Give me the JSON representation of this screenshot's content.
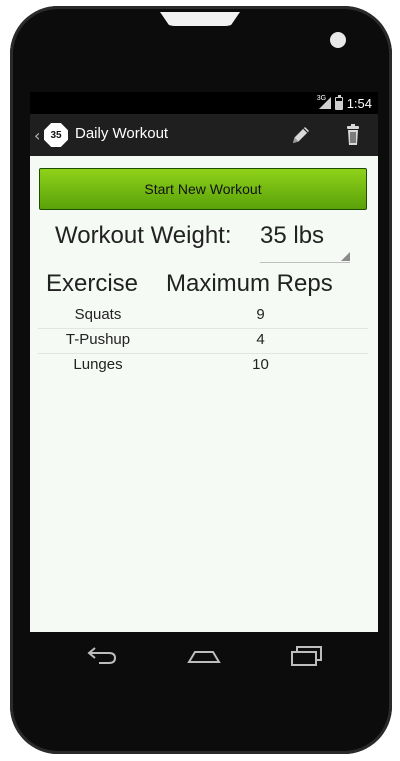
{
  "status_bar": {
    "network": "3G",
    "time": "1:54"
  },
  "action_bar": {
    "app_icon_text": "35",
    "title": "Daily Workout",
    "edit_icon": "pencil-icon",
    "delete_icon": "trash-icon"
  },
  "start_button": {
    "label": "Start New Workout"
  },
  "workout_weight": {
    "label": "Workout Weight:",
    "value": "35 lbs"
  },
  "table": {
    "headers": [
      "Exercise",
      "Maximum Reps"
    ],
    "rows": [
      {
        "exercise": "Squats",
        "reps": "9"
      },
      {
        "exercise": "T-Pushup",
        "reps": "4"
      },
      {
        "exercise": "Lunges",
        "reps": "10"
      }
    ]
  },
  "nav_bar": {
    "back_icon": "back-icon",
    "home_icon": "home-icon",
    "recents_icon": "recent-apps-icon"
  },
  "colors": {
    "accent_green": "#7cc314",
    "action_bar": "#1f1f1f",
    "screen_bg": "#f5faf5"
  }
}
